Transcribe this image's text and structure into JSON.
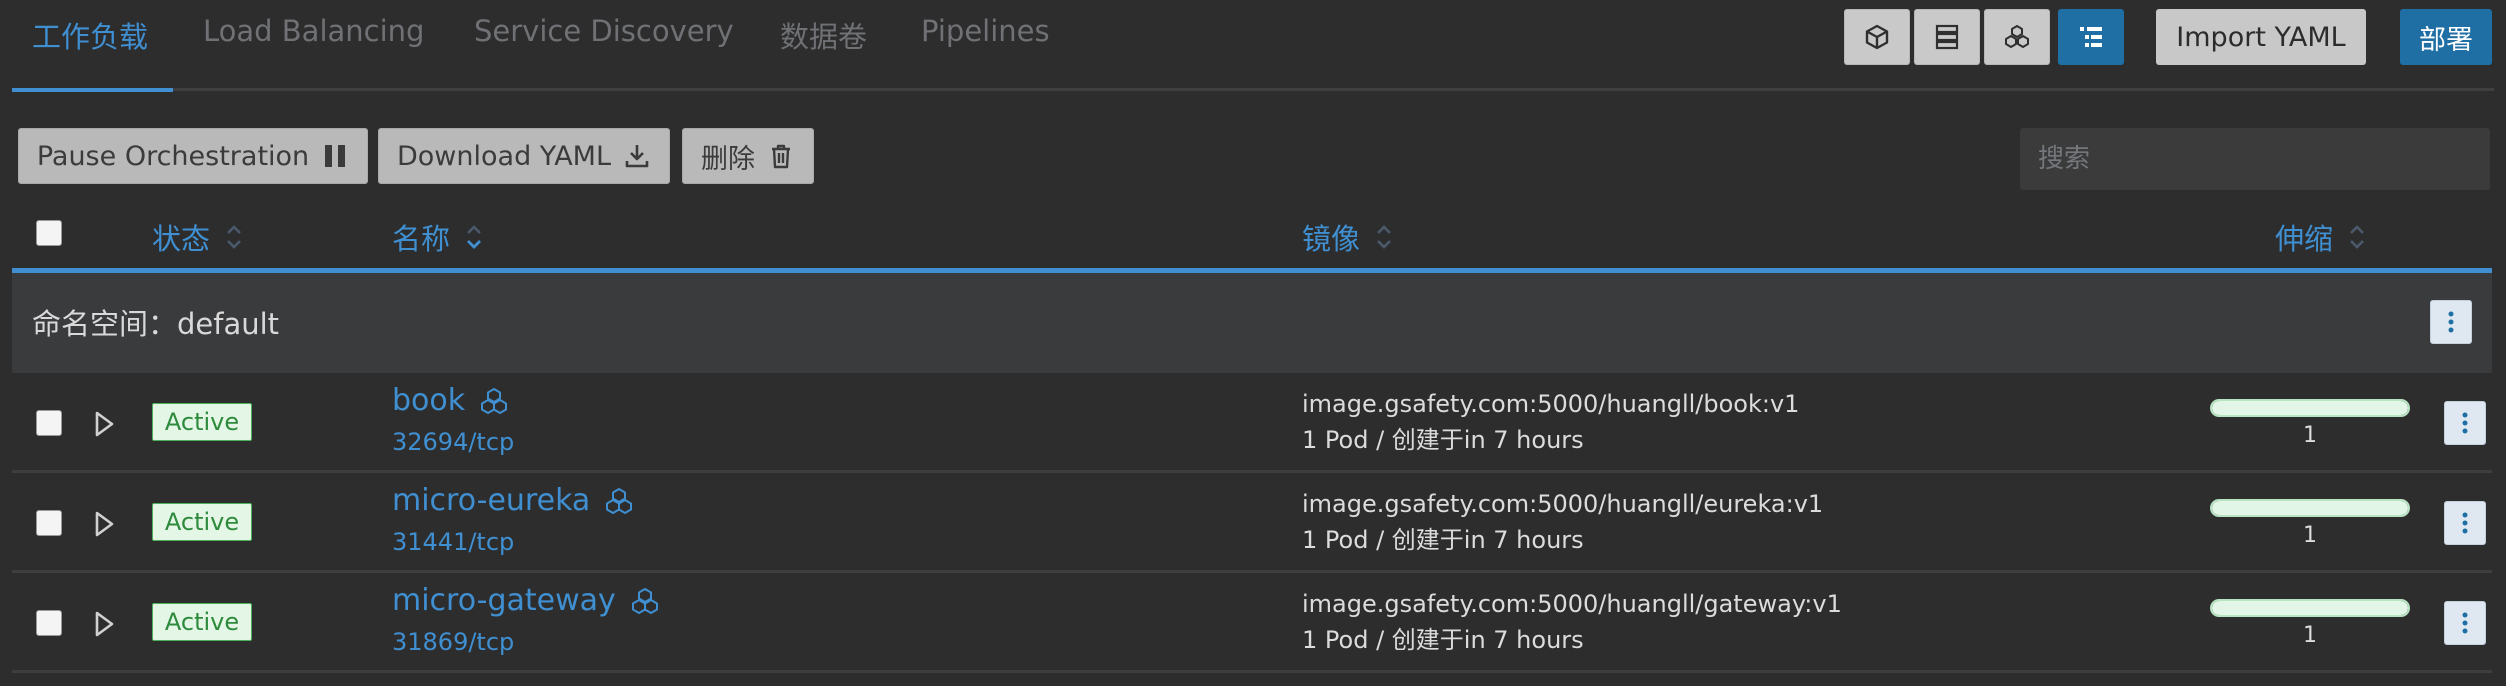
{
  "tabs": [
    {
      "label": "工作负载",
      "active": true
    },
    {
      "label": "Load Balancing",
      "active": false
    },
    {
      "label": "Service Discovery",
      "active": false
    },
    {
      "label": "数据卷",
      "active": false
    },
    {
      "label": "Pipelines",
      "active": false
    }
  ],
  "view_toggles": [
    {
      "icon": "cube-icon",
      "active": false
    },
    {
      "icon": "list-rows-icon",
      "active": false
    },
    {
      "icon": "cluster-icon",
      "active": false
    },
    {
      "icon": "tree-list-icon",
      "active": true
    }
  ],
  "header_actions": {
    "import_label": "Import YAML",
    "deploy_label": "部署"
  },
  "toolbar": {
    "pause_label": "Pause Orchestration",
    "download_label": "Download YAML",
    "delete_label": "删除",
    "search_placeholder": "搜索"
  },
  "columns": {
    "status": "状态",
    "name": "名称",
    "image": "镜像",
    "scale": "伸缩"
  },
  "group": {
    "label": "命名空间：default"
  },
  "rows": [
    {
      "status": "Active",
      "name": "book",
      "port": "32694/tcp",
      "image": "image.gsafety.com:5000/huangll/book:v1",
      "pods": "1 Pod / 创建于in 7 hours",
      "scale": "1",
      "scale_fraction": 1.0
    },
    {
      "status": "Active",
      "name": "micro-eureka",
      "port": "31441/tcp",
      "image": "image.gsafety.com:5000/huangll/eureka:v1",
      "pods": "1 Pod / 创建于in 7 hours",
      "scale": "1",
      "scale_fraction": 1.0
    },
    {
      "status": "Active",
      "name": "micro-gateway",
      "port": "31869/tcp",
      "image": "image.gsafety.com:5000/huangll/gateway:v1",
      "pods": "1 Pod / 创建于in 7 hours",
      "scale": "1",
      "scale_fraction": 1.0
    }
  ],
  "colors": {
    "background": "#2d2d2e",
    "accent": "#3f8fd1",
    "primary_button": "#1f6fa5",
    "active_badge_bg": "#e4f7e6",
    "active_badge_border": "#4caf5b"
  }
}
